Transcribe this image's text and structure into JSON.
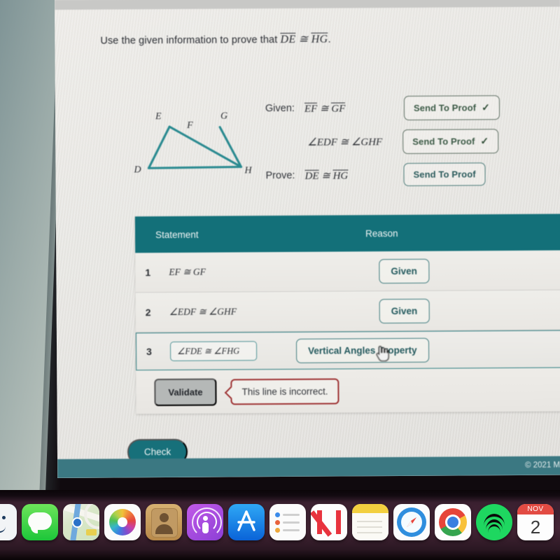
{
  "problem": {
    "prompt_prefix": "Use the given information to prove that",
    "prompt_seg1": "DE",
    "prompt_cong": "≅",
    "prompt_seg2": "HG",
    "prompt_period": "."
  },
  "figure": {
    "label_D": "D",
    "label_E": "E",
    "label_F": "F",
    "label_G": "G",
    "label_H": "H",
    "line_color": "#2a8a90"
  },
  "given_prove": {
    "rows": [
      {
        "label": "Given:",
        "left": "EF",
        "cong": "≅",
        "right": "GF",
        "overline": true,
        "button": "Send To Proof",
        "check": "✓",
        "sent": true
      },
      {
        "label": "",
        "left": "∠EDF",
        "cong": "≅",
        "right": "∠GHF",
        "overline": false,
        "button": "Send To Proof",
        "check": "✓",
        "sent": true
      },
      {
        "label": "Prove:",
        "left": "DE",
        "cong": "≅",
        "right": "HG",
        "overline": true,
        "button": "Send To Proof",
        "check": "",
        "sent": false
      }
    ]
  },
  "proof_table": {
    "headers": {
      "statement": "Statement",
      "reason": "Reason"
    },
    "rows": [
      {
        "num": "1",
        "statement": "EF ≅ GF",
        "reason": "Given",
        "selected": false,
        "boxed": false
      },
      {
        "num": "2",
        "statement": "∠EDF ≅ ∠GHF",
        "reason": "Given",
        "selected": false,
        "boxed": false
      },
      {
        "num": "3",
        "statement": "∠FDE ≅ ∠FHG",
        "reason": "Vertical Angles Property",
        "selected": true,
        "boxed": true
      }
    ],
    "validate_label": "Validate",
    "error_message": "This line is incorrect."
  },
  "actions": {
    "check_label": "Check"
  },
  "footer": {
    "copyright": "© 2021 M"
  },
  "cursor": {
    "type": "pointing-hand-cursor"
  },
  "dock": {
    "items": [
      {
        "name": "finder-icon",
        "label": "Finder"
      },
      {
        "name": "messages-icon",
        "label": "Messages"
      },
      {
        "name": "maps-icon",
        "label": "Maps"
      },
      {
        "name": "photos-icon",
        "label": "Photos"
      },
      {
        "name": "contacts-icon",
        "label": "Contacts"
      },
      {
        "name": "podcasts-icon",
        "label": "Podcasts"
      },
      {
        "name": "app-store-icon",
        "label": "App Store"
      },
      {
        "name": "reminders-icon",
        "label": "Reminders"
      },
      {
        "name": "news-icon",
        "label": "News"
      },
      {
        "name": "notes-icon",
        "label": "Notes"
      },
      {
        "name": "safari-icon",
        "label": "Safari"
      },
      {
        "name": "chrome-icon",
        "label": "Google Chrome"
      },
      {
        "name": "spotify-icon",
        "label": "Spotify"
      },
      {
        "name": "calendar-icon",
        "label": "Calendar"
      }
    ],
    "calendar": {
      "month": "NOV",
      "day": "2"
    }
  },
  "colors": {
    "teal": "#137079",
    "teal_dark": "#17707a",
    "error_red": "#9e3233",
    "figure_teal": "#2a8a90"
  }
}
